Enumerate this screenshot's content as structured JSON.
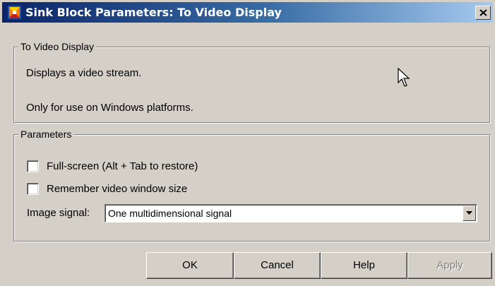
{
  "window": {
    "title": "Sink Block Parameters: To Video Display",
    "title_bar_color": "#0a246a"
  },
  "icons": {
    "title_icon": "simulink-block-icon",
    "close": "close-icon",
    "combo_arrow": "chevron-down-icon",
    "cursor": "mouse-pointer-icon"
  },
  "description_group": {
    "legend": "To Video Display",
    "lines": [
      "Displays a video stream.",
      "Only for use on Windows platforms."
    ]
  },
  "parameters_group": {
    "legend": "Parameters",
    "fullscreen": {
      "label": "Full-screen (Alt + Tab to restore)",
      "checked": false
    },
    "remember_size": {
      "label": "Remember video window size",
      "checked": false
    },
    "image_signal": {
      "label": "Image signal:",
      "value": "One multidimensional signal"
    }
  },
  "buttons": {
    "ok": "OK",
    "cancel": "Cancel",
    "help": "Help",
    "apply": "Apply"
  }
}
